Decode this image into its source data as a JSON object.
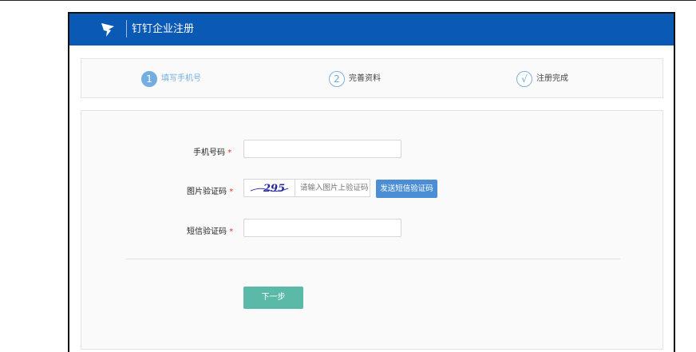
{
  "header": {
    "title": "钉钉企业注册",
    "logo_icon": "dingtalk-logo-icon",
    "bg_color": "#0a5ab5"
  },
  "steps": [
    {
      "number": "1",
      "label": "填写手机号",
      "active": true
    },
    {
      "number": "2",
      "label": "完善资料",
      "active": false
    },
    {
      "number": "√",
      "label": "注册完成",
      "active": false
    }
  ],
  "form": {
    "phone_label": "手机号码",
    "phone_value": "",
    "captcha_label": "图片验证码",
    "captcha_text": "295",
    "captcha_placeholder": "请输入图片上验证码",
    "send_sms_label": "发送短信验证码",
    "sms_label": "短信验证码",
    "sms_value": "",
    "required_mark": "*",
    "next_label": "下一步"
  },
  "colors": {
    "accent": "#4b8ed3",
    "next_button": "#5bbaa7",
    "step_active": "#73aee0"
  }
}
